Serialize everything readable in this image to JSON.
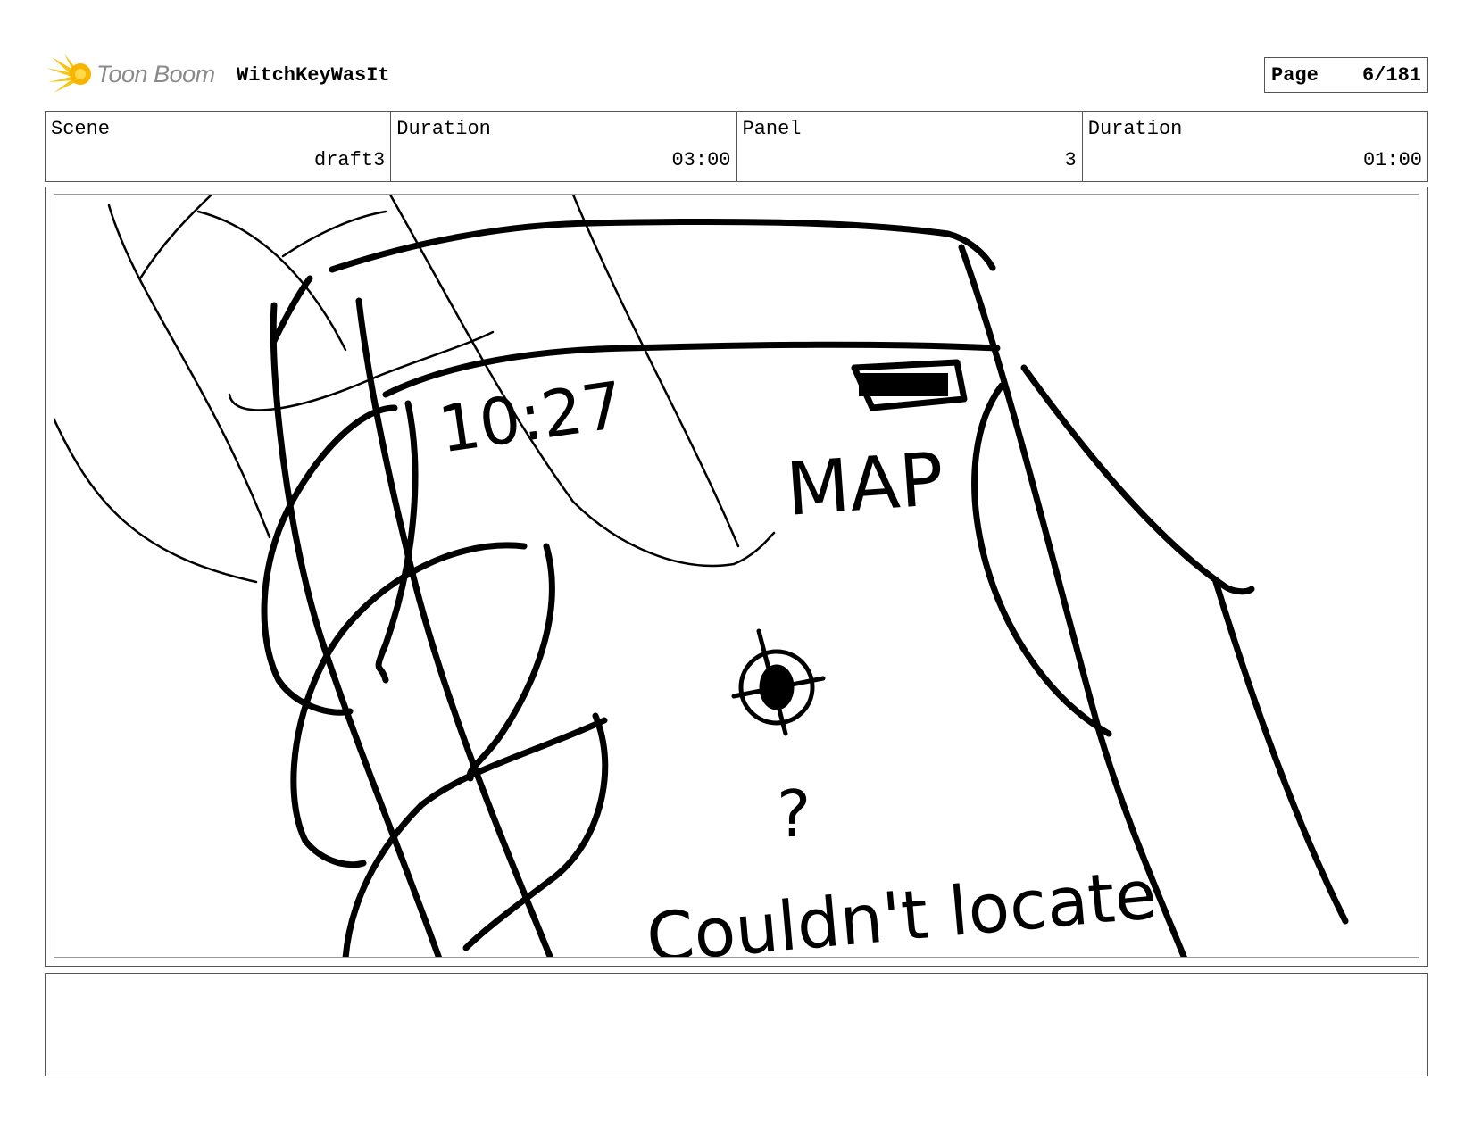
{
  "header": {
    "logo_text": "Toon Boom",
    "project_title": "WitchKeyWasIt",
    "page_label": "Page",
    "page_value": "6/181"
  },
  "info": {
    "scene_label": "Scene",
    "scene_value": "draft3",
    "scene_duration_label": "Duration",
    "scene_duration_value": "03:00",
    "panel_label": "Panel",
    "panel_value": "3",
    "panel_duration_label": "Duration",
    "panel_duration_value": "01:00"
  },
  "sketch": {
    "time_text": "10:27",
    "map_text": "MAP",
    "question_text": "?",
    "status_text": "Couldn't locate"
  },
  "caption": {
    "text": ""
  }
}
